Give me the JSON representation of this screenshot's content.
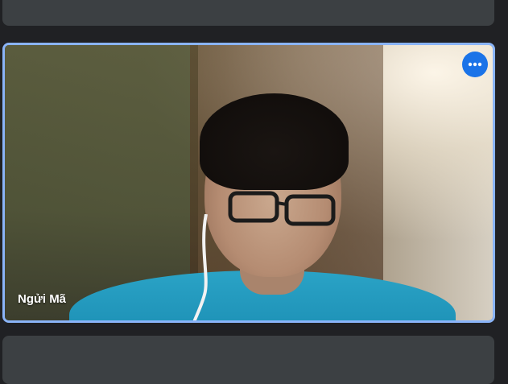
{
  "participant": {
    "name": "Ngửi Mã"
  },
  "controls": {
    "more_options_icon": "more-horiz-icon"
  },
  "colors": {
    "background": "#202124",
    "tile": "#3c4043",
    "active_border": "#8ab4f8",
    "more_button": "#1a73e8"
  }
}
